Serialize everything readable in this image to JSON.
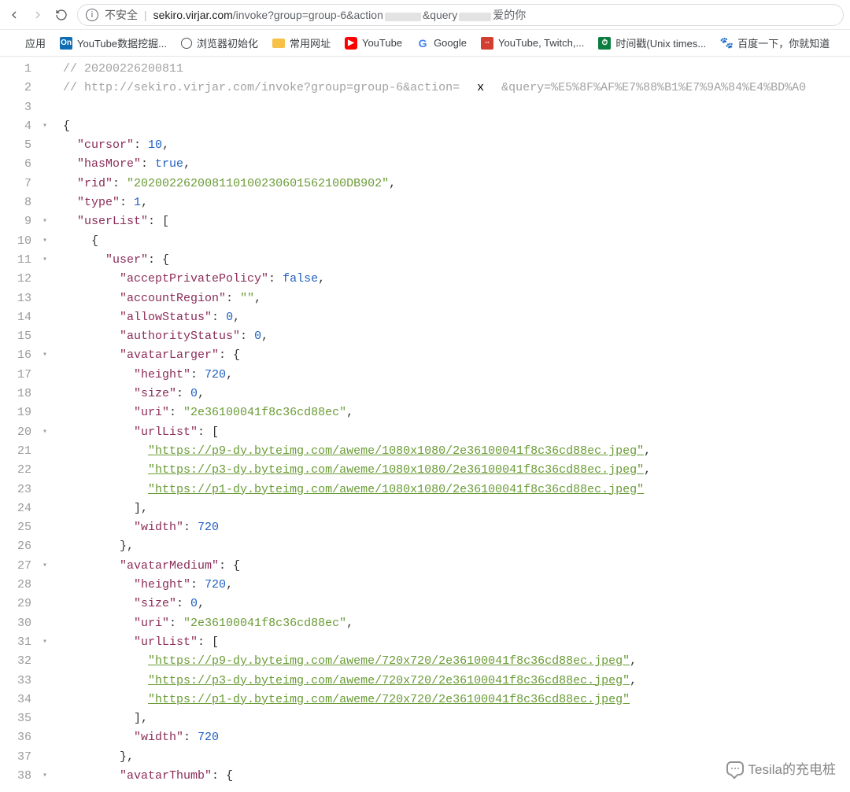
{
  "toolbar": {
    "security_label": "不安全",
    "url_host": "sekiro.virjar.com",
    "url_path_before_blur": "/invoke?group=group-6&action",
    "url_path_mid": "&query",
    "url_path_tail": "爱的你"
  },
  "bookmarks": {
    "apps": "应用",
    "item1": "YouTube数据挖掘...",
    "item2": "浏览器初始化",
    "item3": "常用网址",
    "item4": "YouTube",
    "item5": "Google",
    "item6": "YouTube, Twitch,...",
    "item7": "时间戳(Unix times...",
    "item8": "百度一下，你就知道"
  },
  "code": {
    "comment_ts": "// 20200226200811",
    "comment_url_pre": "// http://sekiro.virjar.com/invoke?group=group-6&action=",
    "comment_url_post": "&query=%E5%8F%AF%E7%88%B1%E7%9A%84%E4%BD%A0",
    "k_cursor": "\"cursor\"",
    "v_cursor": "10",
    "k_hasMore": "\"hasMore\"",
    "v_hasMore": "true",
    "k_rid": "\"rid\"",
    "v_rid": "\"202002262008110100230601562100DB902\"",
    "k_type": "\"type\"",
    "v_type": "1",
    "k_userList": "\"userList\"",
    "k_user": "\"user\"",
    "k_acceptPrivatePolicy": "\"acceptPrivatePolicy\"",
    "v_false": "false",
    "k_accountRegion": "\"accountRegion\"",
    "v_empty": "\"\"",
    "k_allowStatus": "\"allowStatus\"",
    "v_zero": "0",
    "k_authorityStatus": "\"authorityStatus\"",
    "k_avatarLarger": "\"avatarLarger\"",
    "k_height": "\"height\"",
    "v_720": "720",
    "k_size": "\"size\"",
    "k_uri": "\"uri\"",
    "v_uri": "\"2e36100041f8c36cd88ec\"",
    "k_urlList": "\"urlList\"",
    "url_l1": "\"https://p9-dy.byteimg.com/aweme/1080x1080/2e36100041f8c36cd88ec.jpeg\"",
    "url_l2": "\"https://p3-dy.byteimg.com/aweme/1080x1080/2e36100041f8c36cd88ec.jpeg\"",
    "url_l3": "\"https://p1-dy.byteimg.com/aweme/1080x1080/2e36100041f8c36cd88ec.jpeg\"",
    "k_width": "\"width\"",
    "k_avatarMedium": "\"avatarMedium\"",
    "url_m1": "\"https://p9-dy.byteimg.com/aweme/720x720/2e36100041f8c36cd88ec.jpeg\"",
    "url_m2": "\"https://p3-dy.byteimg.com/aweme/720x720/2e36100041f8c36cd88ec.jpeg\"",
    "url_m3": "\"https://p1-dy.byteimg.com/aweme/720x720/2e36100041f8c36cd88ec.jpeg\"",
    "k_avatarThumb": "\"avatarThumb\""
  },
  "lines": [
    "1",
    "2",
    "3",
    "4",
    "5",
    "6",
    "7",
    "8",
    "9",
    "10",
    "11",
    "12",
    "13",
    "14",
    "15",
    "16",
    "17",
    "18",
    "19",
    "20",
    "21",
    "22",
    "23",
    "24",
    "25",
    "26",
    "27",
    "28",
    "29",
    "30",
    "31",
    "32",
    "33",
    "34",
    "35",
    "36",
    "37",
    "38"
  ],
  "folds": [
    "",
    "",
    "",
    "▾",
    "",
    "",
    "",
    "",
    "▾",
    "▾",
    "▾",
    "",
    "",
    "",
    "",
    "▾",
    "",
    "",
    "",
    "▾",
    "",
    "",
    "",
    "",
    "",
    "",
    "▾",
    "",
    "",
    "",
    "▾",
    "",
    "",
    "",
    "",
    "",
    "",
    "▾"
  ],
  "watermark": {
    "text": "Tesila的充电桩"
  }
}
